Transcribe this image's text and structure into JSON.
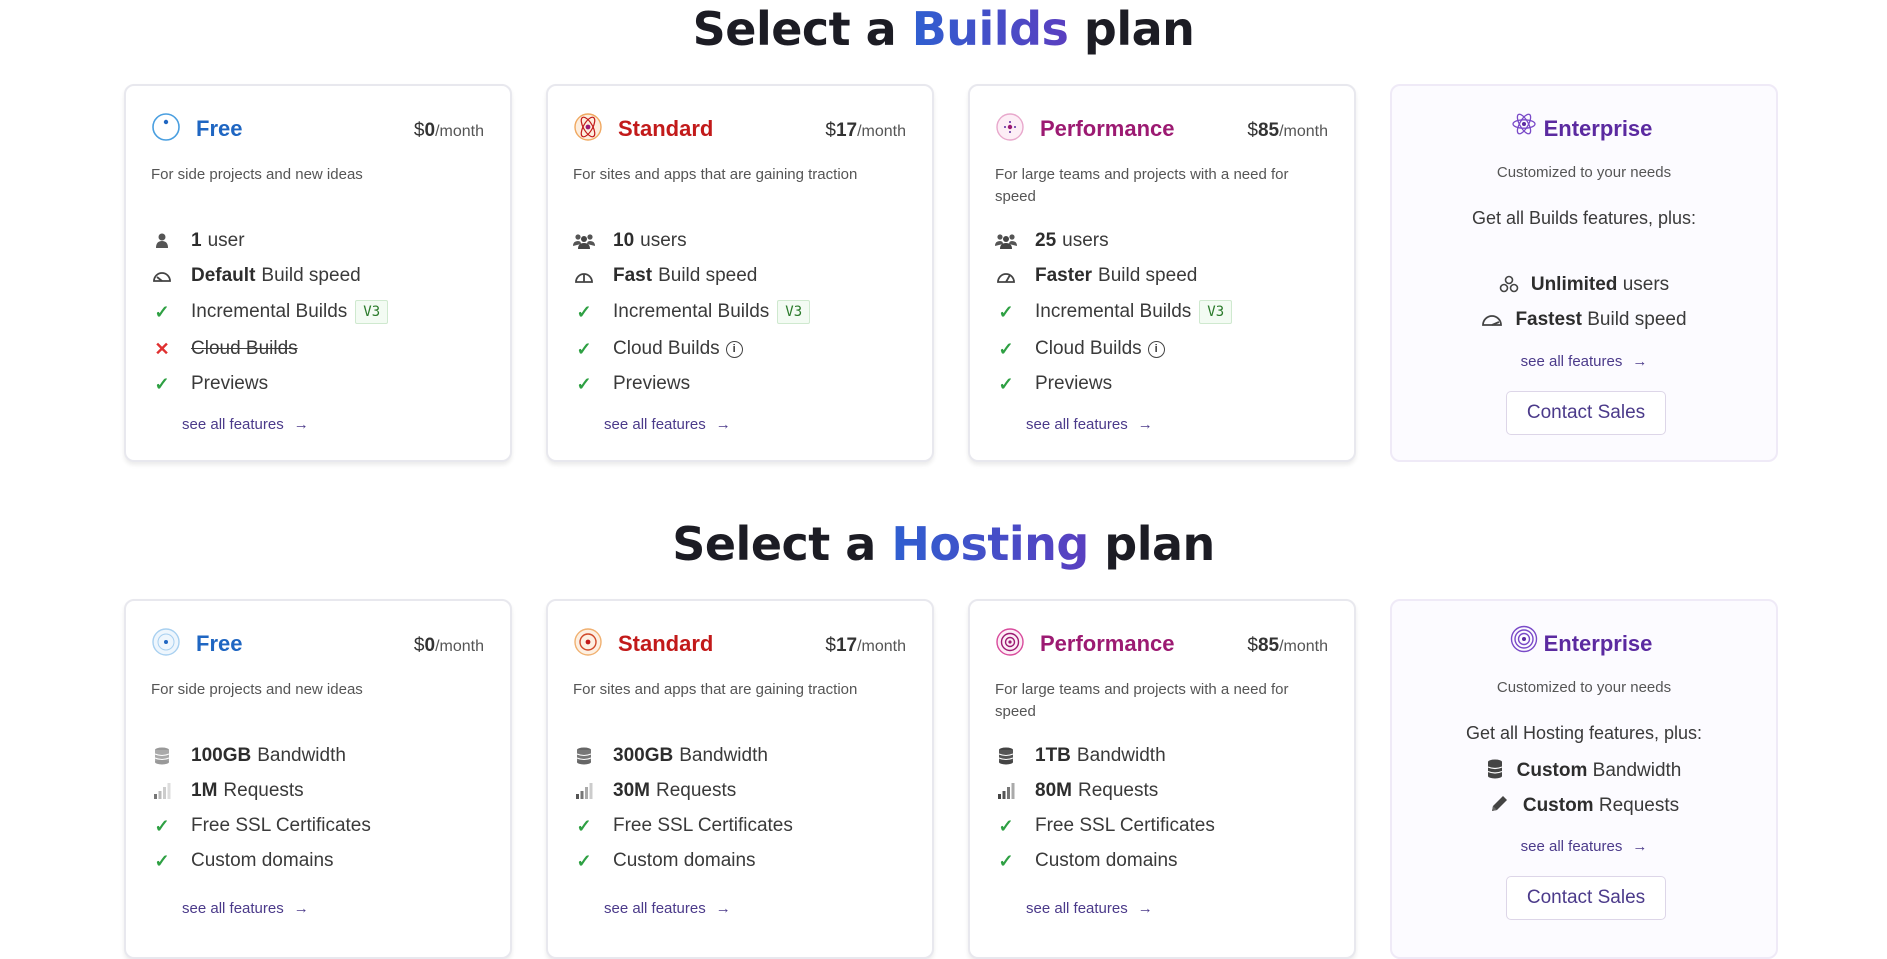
{
  "builds": {
    "title_pre": "Select a",
    "title_hl": "Builds",
    "title_post": "plan",
    "free": {
      "name": "Free",
      "currency": "$",
      "price": "0",
      "period": "/month",
      "desc": "For side projects and new ideas",
      "f1_b": "1",
      "f1": "user",
      "f2_b": "Default",
      "f2": "Build speed",
      "f3": "Incremental Builds",
      "f3_tag": "V3",
      "f4": "Cloud Builds",
      "f5": "Previews",
      "more": "see all features"
    },
    "standard": {
      "name": "Standard",
      "currency": "$",
      "price": "17",
      "period": "/month",
      "desc": "For sites and apps that are gaining traction",
      "f1_b": "10",
      "f1": "users",
      "f2_b": "Fast",
      "f2": "Build speed",
      "f3": "Incremental Builds",
      "f3_tag": "V3",
      "f4": "Cloud Builds",
      "f5": "Previews",
      "more": "see all features"
    },
    "performance": {
      "name": "Performance",
      "currency": "$",
      "price": "85",
      "period": "/month",
      "desc": "For large teams and projects with a need for speed",
      "f1_b": "25",
      "f1": "users",
      "f2_b": "Faster",
      "f2": "Build speed",
      "f3": "Incremental Builds",
      "f3_tag": "V3",
      "f4": "Cloud Builds",
      "f5": "Previews",
      "more": "see all features"
    },
    "enterprise": {
      "name": "Enterprise",
      "desc": "Customized to your needs",
      "plus": "Get all Builds features, plus:",
      "f1_b": "Unlimited",
      "f1": "users",
      "f2_b": "Fastest",
      "f2": "Build speed",
      "more": "see all features",
      "cta": "Contact Sales"
    }
  },
  "hosting": {
    "title_pre": "Select a",
    "title_hl": "Hosting",
    "title_post": "plan",
    "free": {
      "name": "Free",
      "currency": "$",
      "price": "0",
      "period": "/month",
      "desc": "For side projects and new ideas",
      "f1_b": "100GB",
      "f1": "Bandwidth",
      "f2_b": "1M",
      "f2": "Requests",
      "f3": "Free SSL Certificates",
      "f4": "Custom domains",
      "more": "see all features"
    },
    "standard": {
      "name": "Standard",
      "currency": "$",
      "price": "17",
      "period": "/month",
      "desc": "For sites and apps that are gaining traction",
      "f1_b": "300GB",
      "f1": "Bandwidth",
      "f2_b": "30M",
      "f2": "Requests",
      "f3": "Free SSL Certificates",
      "f4": "Custom domains",
      "more": "see all features"
    },
    "performance": {
      "name": "Performance",
      "currency": "$",
      "price": "85",
      "period": "/month",
      "desc": "For large teams and projects with a need for speed",
      "f1_b": "1TB",
      "f1": "Bandwidth",
      "f2_b": "80M",
      "f2": "Requests",
      "f3": "Free SSL Certificates",
      "f4": "Custom domains",
      "more": "see all features"
    },
    "enterprise": {
      "name": "Enterprise",
      "desc": "Customized to your needs",
      "plus": "Get all Hosting features, plus:",
      "f1_b": "Custom",
      "f1": "Bandwidth",
      "f2_b": "Custom",
      "f2": "Requests",
      "more": "see all features",
      "cta": "Contact Sales"
    }
  },
  "colors": {
    "free": "#1f66c2",
    "standard": "#c21a1a",
    "performance": "#9c1a72",
    "enterprise": "#5b2aa0",
    "check": "#2ea043",
    "cross": "#e03030",
    "link": "#4b3a8a"
  }
}
